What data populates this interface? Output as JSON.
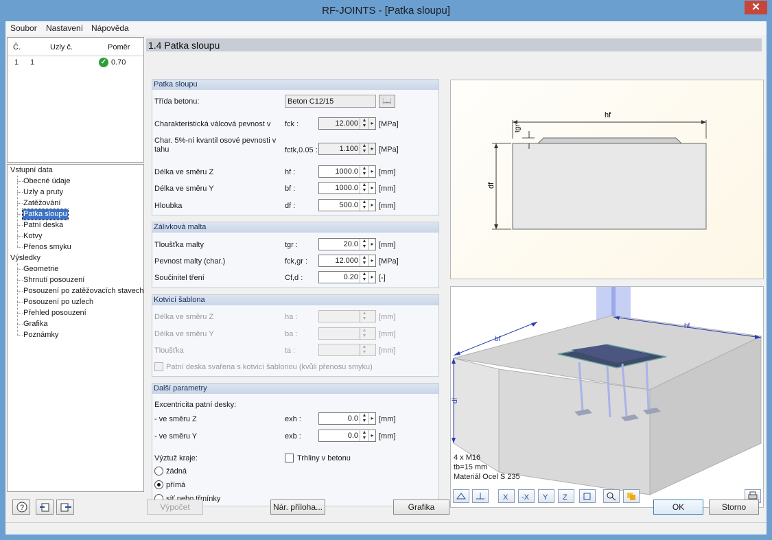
{
  "window": {
    "title": "RF-JOINTS - [Patka sloupu]",
    "close_glyph": "✕"
  },
  "menu": [
    {
      "label": "Soubor"
    },
    {
      "label": "Nastavení"
    },
    {
      "label": "Nápověda"
    }
  ],
  "nodes_table": {
    "headers": {
      "no": "Č.",
      "nodes": "Uzly č.",
      "ratio": "Poměr"
    },
    "rows": [
      {
        "no": "1",
        "nodes": "1",
        "ratio": "0.70",
        "status_icon": "check-circle-icon"
      }
    ]
  },
  "nav": {
    "input_root": "Vstupní data",
    "input_items": [
      "Obecné údaje",
      "Uzly a pruty",
      "Zatěžování",
      "Patka sloupu",
      "Patní deska",
      "Kotvy",
      "Přenos smyku"
    ],
    "results_root": "Výsledky",
    "result_items": [
      "Geometrie",
      "Shrnutí posouzení",
      "Posouzení po zatěžovacích stavech",
      "Posouzení po uzlech",
      "Přehled posouzení",
      "Grafika",
      "Poznámky"
    ],
    "selected": "Patka sloupu"
  },
  "main": {
    "title": "1.4 Patka sloupu",
    "group_footing": {
      "title": "Patka sloupu",
      "concrete_label": "Třída betonu:",
      "concrete_value": "Beton C12/15",
      "fck_label": "Charakteristická válcová pevnost v",
      "fck_sym": "fck :",
      "fck_value": "12.000",
      "fck_unit": "[MPa]",
      "fctk_label_1": "Char. 5%-ní kvantil osové pevnosti v",
      "fctk_label_2": "tahu",
      "fctk_sym": "fctk,0.05 :",
      "fctk_value": "1.100",
      "fctk_unit": "[MPa]",
      "hf_label": "Délka ve směru Z",
      "hf_sym": "hf :",
      "hf_value": "1000.0",
      "hf_unit": "[mm]",
      "bf_label": "Délka ve směru Y",
      "bf_sym": "bf :",
      "bf_value": "1000.0",
      "bf_unit": "[mm]",
      "df_label": "Hloubka",
      "df_sym": "df :",
      "df_value": "500.0",
      "df_unit": "[mm]"
    },
    "group_grout": {
      "title": "Zálivková malta",
      "tgr_label": "Tloušťka malty",
      "tgr_sym": "tgr :",
      "tgr_value": "20.0",
      "tgr_unit": "[mm]",
      "fckgr_label": "Pevnost malty (char.)",
      "fckgr_sym": "fck,gr :",
      "fckgr_value": "12.000",
      "fckgr_unit": "[MPa]",
      "cfd_label": "Součinitel tření",
      "cfd_sym": "Cf,d :",
      "cfd_value": "0.20",
      "cfd_unit": "[-]"
    },
    "group_template": {
      "title": "Kotvicí šablona",
      "ha_label": "Délka ve směru Z",
      "ha_sym": "ha :",
      "ha_unit": "[mm]",
      "ba_label": "Délka ve směru Y",
      "ba_sym": "ba :",
      "ba_unit": "[mm]",
      "ta_label": "Tloušťka",
      "ta_sym": "ta :",
      "ta_unit": "[mm]",
      "weld_label": "Patní deska svařena s kotvicí šablonou (kvůli přenosu smyku)"
    },
    "group_other": {
      "title": "Další parametry",
      "ecc_label": "Excentricita patní desky:",
      "exh_label": "- ve směru Z",
      "exh_sym": "exh :",
      "exh_value": "0.0",
      "exh_unit": "[mm]",
      "exb_label": "- ve směru Y",
      "exb_sym": "exb :",
      "exb_value": "0.0",
      "exb_unit": "[mm]",
      "edge_label": "Výztuž kraje:",
      "edge_options": [
        "žádná",
        "přímá",
        "síť nebo třmínky"
      ],
      "edge_selected": "přímá",
      "cracks_label": "Trhliny v betonu"
    }
  },
  "drawing_top": {
    "label_hf": "hf",
    "label_tgr": "tgr",
    "label_df": "df"
  },
  "drawing_bottom": {
    "label_bf": "bf",
    "label_hf": "hf",
    "label_df": "df",
    "info_1": "4 x M16",
    "info_2": "tb=15 mm",
    "info_3": "Materiál Ocel S 235"
  },
  "buttons": {
    "calc": "Výpočet",
    "annex": "Nár. příloha...",
    "graphics": "Grafika",
    "ok": "OK",
    "cancel": "Storno"
  }
}
